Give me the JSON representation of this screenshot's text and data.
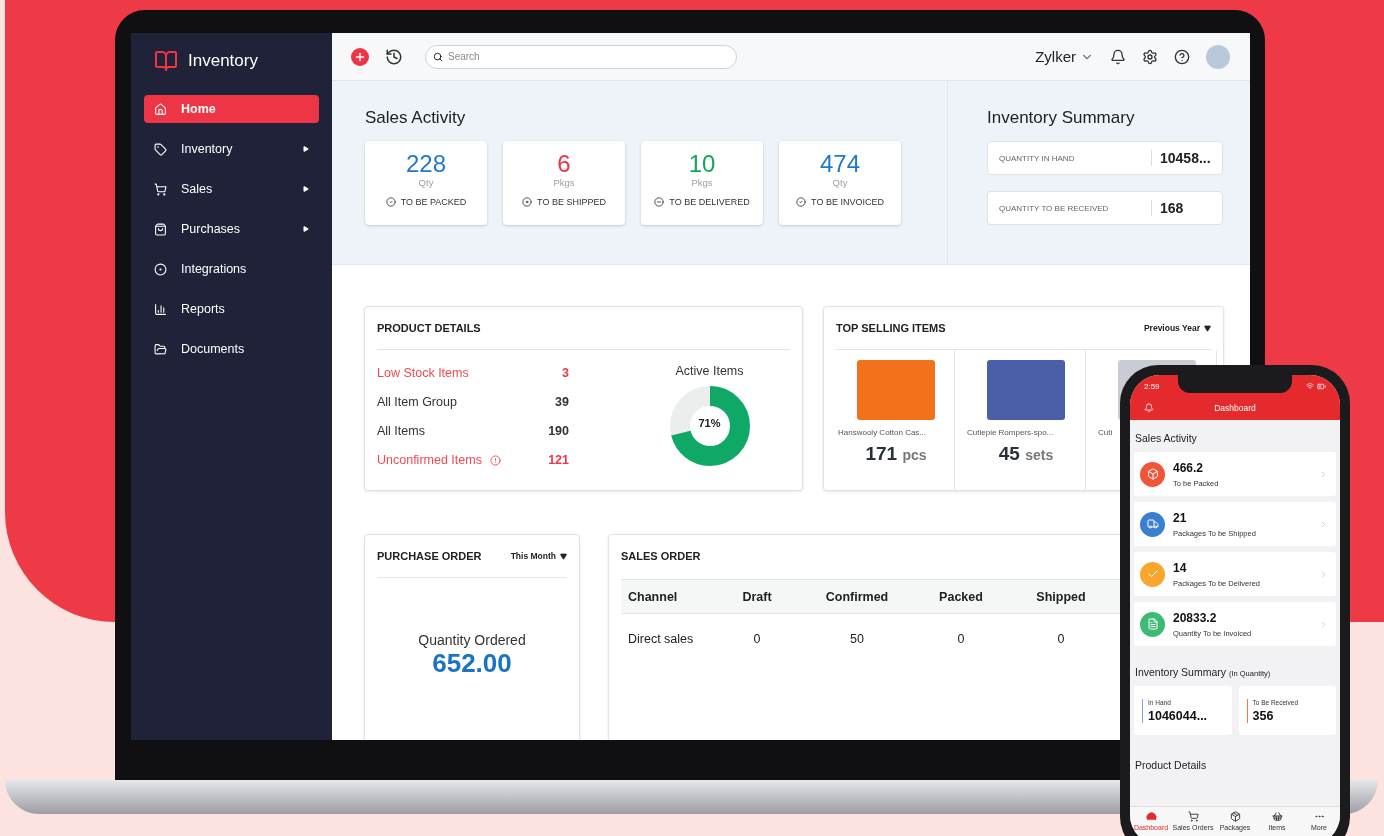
{
  "sidebar": {
    "app_name": "Inventory",
    "items": [
      {
        "label": "Home",
        "selected": true,
        "has_submenu": false
      },
      {
        "label": "Inventory",
        "selected": false,
        "has_submenu": true
      },
      {
        "label": "Sales",
        "selected": false,
        "has_submenu": true
      },
      {
        "label": "Purchases",
        "selected": false,
        "has_submenu": true
      },
      {
        "label": "Integrations",
        "selected": false,
        "has_submenu": false
      },
      {
        "label": "Reports",
        "selected": false,
        "has_submenu": false
      },
      {
        "label": "Documents",
        "selected": false,
        "has_submenu": false
      }
    ]
  },
  "topbar": {
    "search": {
      "placeholder": "Search"
    },
    "organization": "Zylker"
  },
  "sales_activity": {
    "title": "Sales Activity",
    "cards": [
      {
        "value": "228",
        "unit": "Qty",
        "label": "TO BE PACKED",
        "color": "#1f78c8",
        "kind": "check"
      },
      {
        "value": "6",
        "unit": "Pkgs",
        "label": "TO BE SHIPPED",
        "color": "#ee3545",
        "kind": "dot"
      },
      {
        "value": "10",
        "unit": "Pkgs",
        "label": "TO BE DELIVERED",
        "color": "#12a65a",
        "kind": "minus"
      },
      {
        "value": "474",
        "unit": "Qty",
        "label": "TO BE INVOICED",
        "color": "#1f78c8",
        "kind": "check"
      }
    ]
  },
  "inventory_summary": {
    "title": "Inventory Summary",
    "rows": [
      {
        "label": "QUANTITY IN HAND",
        "value": "10458..."
      },
      {
        "label": "QUANTITY TO BE RECEIVED",
        "value": "168"
      }
    ]
  },
  "product_details": {
    "title": "PRODUCT DETAILS",
    "rows": [
      {
        "label": "Low Stock Items",
        "value": "3",
        "alert": true,
        "warning": false
      },
      {
        "label": "All Item Group",
        "value": "39",
        "alert": false,
        "warning": false
      },
      {
        "label": "All Items",
        "value": "190",
        "alert": false,
        "warning": false
      },
      {
        "label": "Unconfirmed Items",
        "value": "121",
        "alert": true,
        "warning": true
      }
    ],
    "active_items": {
      "title": "Active Items",
      "level": 0.71,
      "reading": "71%"
    }
  },
  "top_selling": {
    "title": "TOP SELLING ITEMS",
    "filter": "Previous Year",
    "items": [
      {
        "name": "Hanswooly Cotton Cas...",
        "quantity": "171",
        "unit": "pcs"
      },
      {
        "name": "Cutiepie Rompers-spo...",
        "quantity": "45",
        "unit": "sets"
      },
      {
        "name": "Cuti"
      }
    ]
  },
  "purchase_order": {
    "title": "PURCHASE ORDER",
    "filter": "This Month",
    "caption": "Quantity Ordered",
    "value": "652.00"
  },
  "sales_order": {
    "title": "SALES ORDER",
    "columns": [
      "Channel",
      "Draft",
      "Confirmed",
      "Packed",
      "Shipped"
    ],
    "rows": [
      [
        "Direct sales",
        "0",
        "50",
        "0",
        "0"
      ]
    ]
  },
  "phone": {
    "time": "2:59",
    "title": "Dashboard",
    "sales_title": "Sales Activity",
    "cards": [
      {
        "value": "466.2",
        "label": "To be Packed",
        "color": "#f0553a",
        "kind": "box"
      },
      {
        "value": "21",
        "label": "Packages To be Shipped",
        "color": "#3b7fd0",
        "kind": "truck"
      },
      {
        "value": "14",
        "label": "Packages To be Delivered",
        "color": "#f8a62e",
        "kind": "check"
      },
      {
        "value": "20833.2",
        "label": "Quantity To be Invoiced",
        "color": "#3dba73",
        "kind": "file"
      }
    ],
    "summary_title": "Inventory Summary",
    "summary_note": "(In Quantity)",
    "summary": [
      {
        "label": "In Hand",
        "value": "1046044...",
        "color": "#6fa6e2"
      },
      {
        "label": "To Be Received",
        "value": "356",
        "color": "#f07a4a"
      }
    ],
    "section": "Product Details",
    "tabs": [
      {
        "label": "Dashboard",
        "selected": true
      },
      {
        "label": "Sales Orders",
        "selected": false
      },
      {
        "label": "Packages",
        "selected": false
      },
      {
        "label": "Items",
        "selected": false
      },
      {
        "label": "More",
        "selected": false
      }
    ]
  }
}
